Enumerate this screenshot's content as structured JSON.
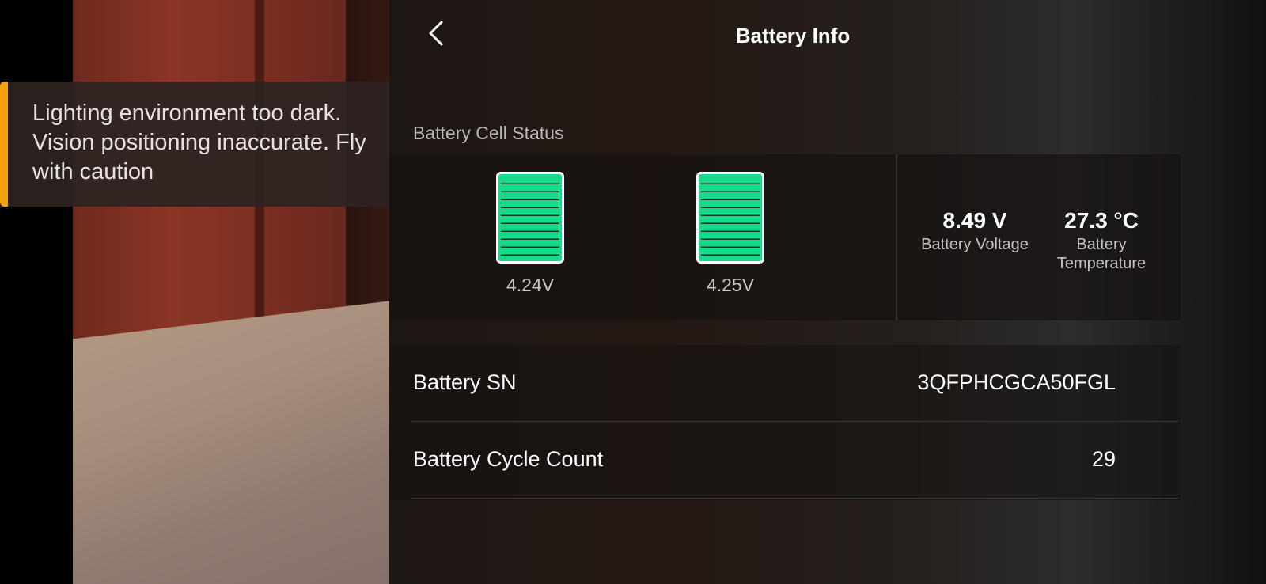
{
  "warning": {
    "text": "Lighting environment too dark. Vision positioning inaccurate. Fly with caution",
    "accent_color": "#f2a20c"
  },
  "header": {
    "title": "Battery Info",
    "back_icon": "chevron-left-icon"
  },
  "cell_status": {
    "section_label": "Battery Cell Status",
    "cells": [
      {
        "voltage": "4.24V",
        "fill_fraction": 1.0
      },
      {
        "voltage": "4.25V",
        "fill_fraction": 1.0
      }
    ],
    "cell_color": "#16d98a"
  },
  "stats": {
    "voltage_value": "8.49 V",
    "voltage_label": "Battery Voltage",
    "temperature_value": "27.3 °C",
    "temperature_label": "Battery Temperature"
  },
  "info": {
    "rows": [
      {
        "key": "Battery SN",
        "value": "3QFPHCGCA50FGL"
      },
      {
        "key": "Battery Cycle Count",
        "value": "29"
      }
    ]
  }
}
